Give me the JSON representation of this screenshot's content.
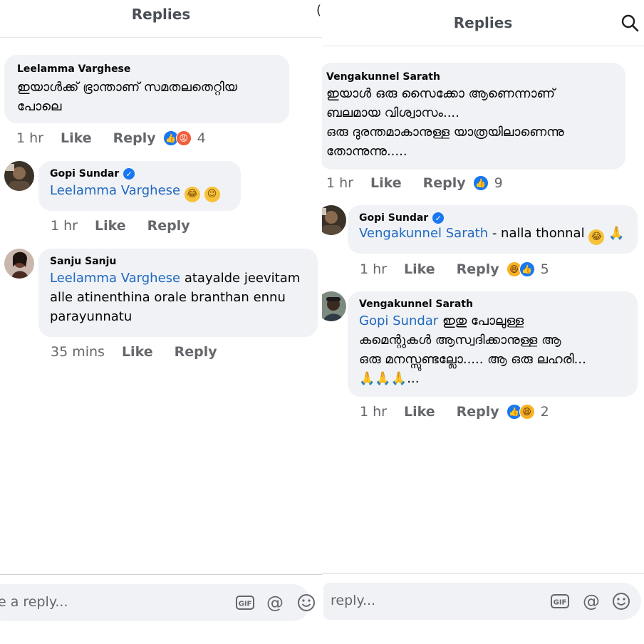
{
  "left": {
    "title": "Replies",
    "comments": [
      {
        "author": "Leelamma Varghese",
        "text_lines": [
          "ഇയാൾക്ക് ഭ്രാന്താണ് സമതലതെറ്റിയ",
          "പോലെ"
        ],
        "time": "1 hr",
        "like": "Like",
        "reply": "Reply",
        "reactions": [
          "like",
          "angry"
        ],
        "reaction_count": "4"
      },
      {
        "author": "Gopi Sundar",
        "mention": "Leelamma Varghese",
        "emojis": [
          "tears-of-joy-hug",
          "wink"
        ],
        "time": "1 hr",
        "like": "Like",
        "reply": "Reply"
      },
      {
        "author": "Sanju Sanju",
        "mention": "Leelamma Varghese",
        "text_after_mention": " atayalde jeevitam",
        "text_lines": [
          "alle atinenthina orale branthan ennu",
          "parayunnatu"
        ],
        "time": "35 mins",
        "like": "Like",
        "reply": "Reply"
      }
    ],
    "reply_placeholder": "e a reply..."
  },
  "right": {
    "title": "Replies",
    "comments": [
      {
        "author": "Vengakunnel Sarath",
        "text_lines": [
          "ഇയാൾ ഒരു സൈക്കോ ആണെന്നാണ്",
          "ബലമായ വിശ്വാസം....",
          "ഒരു ദുരന്തമാകാനുള്ള യാത്രയിലാണെന്നു",
          "തോന്നുന്നു....."
        ],
        "time": "1 hr",
        "like": "Like",
        "reply": "Reply",
        "reactions": [
          "like"
        ],
        "reaction_count": "9"
      },
      {
        "author": "Gopi Sundar",
        "mention": "Vengakunnel Sarath",
        "text_after_mention": " - nalla thonnal",
        "emojis": [
          "laughing",
          "folded-hands"
        ],
        "time": "1 hr",
        "like": "Like",
        "reply": "Reply",
        "reactions": [
          "haha",
          "like"
        ],
        "reaction_count": "5"
      },
      {
        "author": "Vengakunnel Sarath",
        "mention": "Gopi Sundar",
        "text_after_mention": " ഇതു പോലുള്ള",
        "text_lines": [
          "കമെന്റുകൾ ആസ്വദിക്കാനുള്ള ആ",
          "ഒരു മനസ്സുണ്ടല്ലോ.....  ആ ഒരു ലഹരി..."
        ],
        "last_line_suffix": "...",
        "time": "1 hr",
        "like": "Like",
        "reply": "Reply",
        "reactions": [
          "like",
          "haha"
        ],
        "reaction_count": "2"
      }
    ],
    "reply_placeholder": "reply..."
  },
  "icons": {
    "verified": "✓",
    "gif": "GIF",
    "at": "@"
  },
  "colors": {
    "mention": "#1f68c1",
    "bubble": "#f0f2f5",
    "meta": "#65676b",
    "like_blue": "#1877f2"
  }
}
